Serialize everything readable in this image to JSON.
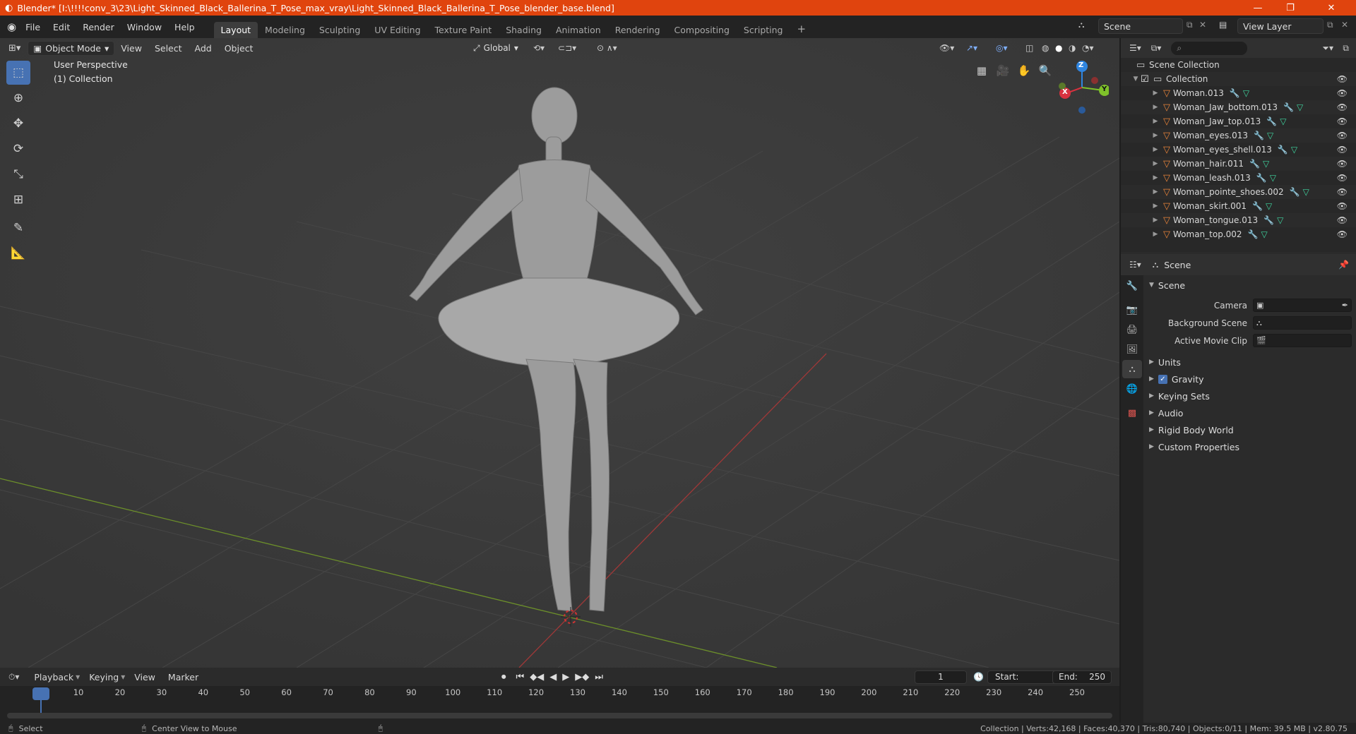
{
  "window": {
    "title": "Blender* [I:\\!!!!conv_3\\23\\Light_Skinned_Black_Ballerina_T_Pose_max_vray\\Light_Skinned_Black_Ballerina_T_Pose_blender_base.blend]",
    "controls": {
      "minimize": "—",
      "maximize": "❐",
      "close": "✕"
    }
  },
  "menu": [
    "File",
    "Edit",
    "Render",
    "Window",
    "Help"
  ],
  "workspaces": [
    "Layout",
    "Modeling",
    "Sculpting",
    "UV Editing",
    "Texture Paint",
    "Shading",
    "Animation",
    "Rendering",
    "Compositing",
    "Scripting"
  ],
  "workspace_add": "+",
  "active_workspace": "Layout",
  "scene_selector": {
    "value": "Scene"
  },
  "view_layer_selector": {
    "value": "View Layer"
  },
  "viewport": {
    "mode": "Object Mode",
    "menus": [
      "View",
      "Select",
      "Add",
      "Object"
    ],
    "orientation": "Global",
    "overlay_line1": "User Perspective",
    "overlay_line2": "(1) Collection",
    "gizmo_axes": {
      "x": "X",
      "y": "Y",
      "z": "Z"
    }
  },
  "outliner": {
    "root": "Scene Collection",
    "collection": "Collection",
    "objects": [
      "Woman.013",
      "Woman_Jaw_bottom.013",
      "Woman_Jaw_top.013",
      "Woman_eyes.013",
      "Woman_eyes_shell.013",
      "Woman_hair.011",
      "Woman_leash.013",
      "Woman_pointe_shoes.002",
      "Woman_skirt.001",
      "Woman_tongue.013",
      "Woman_top.002"
    ]
  },
  "properties": {
    "header": "Scene",
    "section": "Scene",
    "fields": [
      {
        "label": "Camera",
        "value": ""
      },
      {
        "label": "Background Scene",
        "value": ""
      },
      {
        "label": "Active Movie Clip",
        "value": ""
      }
    ],
    "subsections": [
      "Units",
      "Gravity",
      "Keying Sets",
      "Audio",
      "Rigid Body World",
      "Custom Properties"
    ],
    "gravity_checked": true
  },
  "timeline": {
    "menus": [
      "Playback",
      "Keying",
      "View",
      "Marker"
    ],
    "current_frame": "1",
    "start_label": "Start:",
    "start": "1",
    "end_label": "End:",
    "end": "250",
    "ticks": [
      "1",
      "10",
      "20",
      "30",
      "40",
      "50",
      "60",
      "70",
      "80",
      "90",
      "100",
      "110",
      "120",
      "130",
      "140",
      "150",
      "160",
      "170",
      "180",
      "190",
      "200",
      "210",
      "220",
      "230",
      "240",
      "250"
    ]
  },
  "statusbar": {
    "left_action": "Select",
    "mid_action": "Center View to Mouse",
    "stats": "Collection | Verts:42,168 | Faces:40,370 | Tris:80,740 | Objects:0/11 | Mem: 39.5 MB | v2.80.75"
  },
  "colors": {
    "title_bar": "#e0440e",
    "accent": "#4772b3",
    "x_axis": "#d9323f",
    "y_axis": "#7ec12a",
    "z_axis": "#2f85e0",
    "mesh_icon": "#e9843a"
  }
}
